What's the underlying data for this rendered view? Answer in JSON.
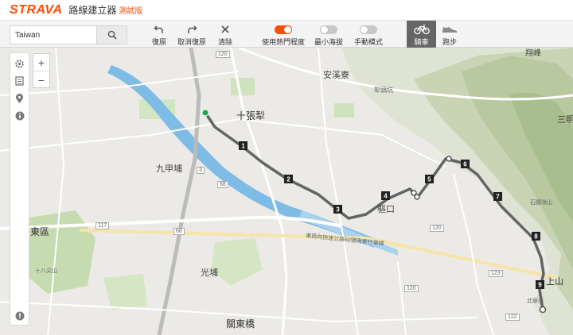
{
  "brand": {
    "logo": "STRAVA",
    "title": "路線建立器",
    "beta": "測試版"
  },
  "search": {
    "value": "Taiwan",
    "icon": "search-icon"
  },
  "toolbar": {
    "undo": "復原",
    "redo": "取消復原",
    "clear": "清除",
    "popularity": "使用熱門程度",
    "min_elevation": "最小海拔",
    "manual": "手動模式",
    "ride": "騎車",
    "run": "跑步"
  },
  "toggles": {
    "popularity": true,
    "min_elevation": false,
    "manual": false
  },
  "route": {
    "markers": [
      "1",
      "2",
      "3",
      "4",
      "5",
      "6",
      "7",
      "8",
      "9"
    ]
  },
  "map_labels": {
    "anxi": "安溪寮",
    "shizhangli": "十張犁",
    "jiujiapu": "九甲埔",
    "tunkou": "樞口",
    "guangpu": "光埔",
    "guandongqiao": "關東橋",
    "east_district": "東區",
    "shangshan": "上山",
    "sanming": "三明",
    "yunfeng": "翔峰",
    "road_120a": "120",
    "road_120b": "120",
    "road_120c": "120",
    "road_117": "117",
    "road_68": "68",
    "road_123": "123",
    "road_122": "122",
    "road_68b": "68",
    "road_3": "3",
    "xikeng": "犁頭坑",
    "shichuan": "石鐵嶺山",
    "beidong": "北寮山",
    "shanshang": "十八尖山",
    "east_road": "東西向快速公路68號南寮竹東線"
  }
}
